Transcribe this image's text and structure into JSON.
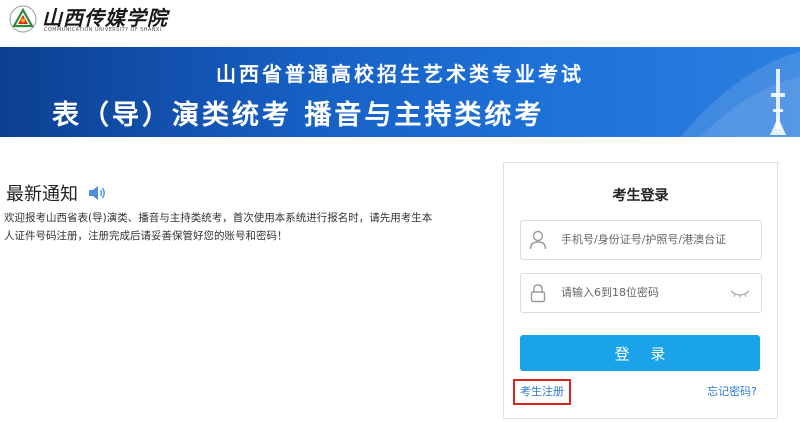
{
  "header": {
    "logo_name": "山西传媒学院",
    "logo_subtitle": "COMMUNICATION UNIVERSITY OF SHANXI"
  },
  "banner": {
    "line1": "山西省普通高校招生艺术类专业考试",
    "line2": "表（导）演类统考 播音与主持类统考"
  },
  "news": {
    "title": "最新通知",
    "body": "欢迎报考山西省表(导)演类、播音与主持类统考，首次使用本系统进行报名时，请先用考生本人证件号码注册，注册完成后请妥善保管好您的账号和密码！"
  },
  "login": {
    "title": "考生登录",
    "id_value": "",
    "id_placeholder": "手机号/身份证号/护照号/港澳台证",
    "password_value": "",
    "password_placeholder": "请输入6到18位密码",
    "submit_label": "登 录",
    "register_label": "考生注册",
    "forgot_label": "忘记密码?"
  },
  "colors": {
    "banner_blue": "#1761c6",
    "button_blue": "#1aa3e8",
    "link_blue": "#2d7ad6",
    "highlight_red": "#e02424"
  },
  "icons": {
    "logo": "school-emblem-icon",
    "news": "speaker-icon",
    "id_field": "user-icon",
    "password_field": "lock-icon",
    "password_toggle": "eye-closed-icon"
  }
}
